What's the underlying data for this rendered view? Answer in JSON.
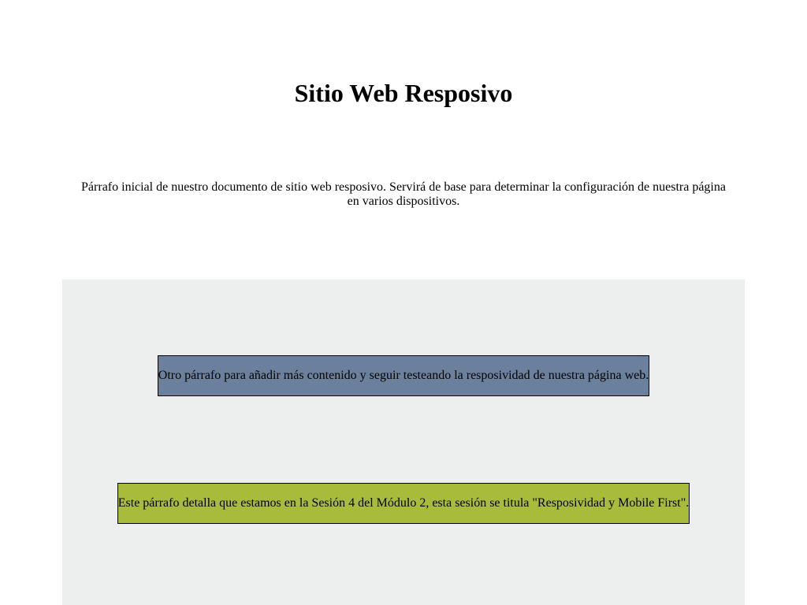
{
  "header": {
    "title": "Sitio Web Resposivo"
  },
  "intro": {
    "text": "Párrafo inicial de nuestro documento de sitio web resposivo. Servirá de base para determinar la configuración de nuestra página en varios dispositivos."
  },
  "section": {
    "background_color": "#edeeee",
    "paragraphs": [
      {
        "text": "Otro párrafo para añadir más contenido y seguir testeando la resposividad de nuestra página web.",
        "background_color": "#6a809c"
      },
      {
        "text": "Este párrafo detalla que estamos en la Sesión 4 del Módulo 2, esta sesión se titula \"Resposividad y Mobile First\".",
        "background_color": "#a9bb3b"
      }
    ]
  }
}
